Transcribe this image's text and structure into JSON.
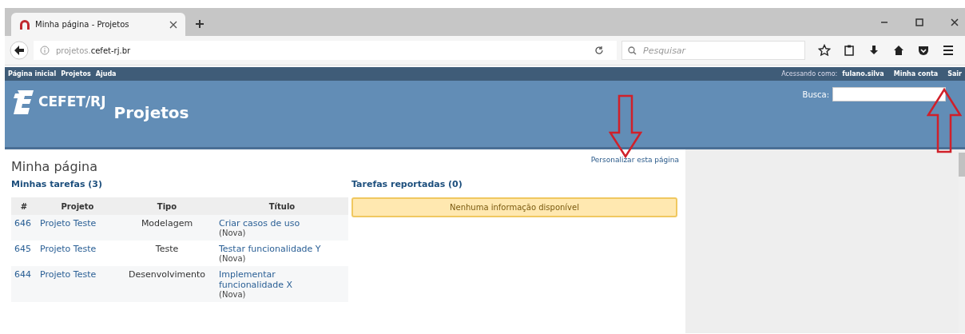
{
  "browser": {
    "tab_title": "Minha página - Projetos",
    "url_host": "projetos.",
    "url_domain": "cefet-rj.br",
    "search_placeholder": "Pesquisar"
  },
  "top_menu": {
    "links": [
      "Página inicial",
      "Projetos",
      "Ajuda"
    ],
    "logged_in_label": "Acessando como:",
    "user": "fulano.silva",
    "account_links": [
      "Minha conta",
      "Sair"
    ]
  },
  "header": {
    "logo_text": "CEFET/RJ",
    "title": "Projetos",
    "search_label": "Busca:"
  },
  "page": {
    "title": "Minha página",
    "personalize_link": "Personalizar esta página"
  },
  "my_tasks": {
    "heading": "Minhas tarefas (3)",
    "columns": [
      "#",
      "Projeto",
      "Tipo",
      "Título"
    ],
    "rows": [
      {
        "id": "646",
        "project": "Projeto Teste",
        "type": "Modelagem",
        "title": "Criar casos de uso",
        "status": "(Nova)"
      },
      {
        "id": "645",
        "project": "Projeto Teste",
        "type": "Teste",
        "title": "Testar funcionalidade Y",
        "status": "(Nova)"
      },
      {
        "id": "644",
        "project": "Projeto Teste",
        "type": "Desenvolvimento",
        "title": "Implementar funcionalidade X",
        "status": "(Nova)"
      }
    ]
  },
  "reported_tasks": {
    "heading": "Tarefas reportadas (0)",
    "empty_message": "Nenhuma informação disponível"
  },
  "annotations": [
    {
      "kind": "arrow-down"
    },
    {
      "kind": "arrow-up"
    }
  ]
}
